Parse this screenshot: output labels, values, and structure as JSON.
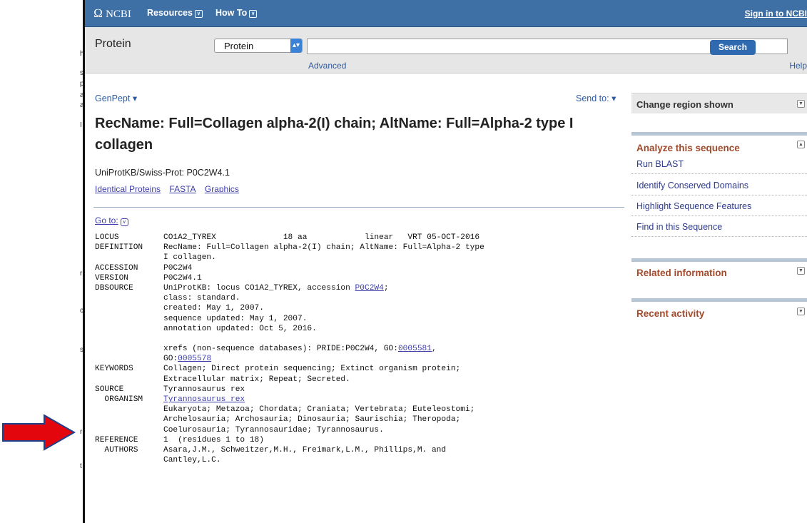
{
  "left_fragments": [
    "h",
    "s",
    "p",
    "a",
    "a",
    "I",
    "r",
    "c",
    "s",
    "r",
    "t"
  ],
  "topbar": {
    "logo_glyph": "Ω",
    "logo": "NCBI",
    "resources": "Resources",
    "howto": "How To",
    "caret": "∨",
    "signin": "Sign in to NCBI"
  },
  "search": {
    "db_label": "Protein",
    "db_value": "Protein",
    "db_arrow": "▴▾",
    "query": "",
    "button": "Search",
    "advanced": "Advanced",
    "help": "Help"
  },
  "main": {
    "format": "GenPept",
    "format_caret": "▾",
    "send_to": "Send to:",
    "send_caret": "▾",
    "title": "RecName: Full=Collagen alpha-2(I) chain; AltName: Full=Alpha-2 type I collagen",
    "accession_line": "UniProtKB/Swiss-Prot: P0C2W4.1",
    "links": [
      "Identical Proteins",
      "FASTA",
      "Graphics"
    ],
    "goto": "Go to:",
    "goto_caret": "∨"
  },
  "record": [
    {
      "key": "LOCUS",
      "text": "CO1A2_TYREX              18 aa            linear   VRT 05-OCT-2016"
    },
    {
      "key": "DEFINITION",
      "text": "RecName: Full=Collagen alpha-2(I) chain; AltName: Full=Alpha-2 type"
    },
    {
      "key": "",
      "text": "I collagen."
    },
    {
      "key": "ACCESSION",
      "text": "P0C2W4"
    },
    {
      "key": "VERSION",
      "text": "P0C2W4.1"
    },
    {
      "key": "DBSOURCE",
      "text": "UniProtKB: locus CO1A2_TYREX, accession ",
      "link": "P0C2W4",
      "after": ";"
    },
    {
      "key": "",
      "text": "class: standard."
    },
    {
      "key": "",
      "text": "created: May 1, 2007."
    },
    {
      "key": "",
      "text": "sequence updated: May 1, 2007."
    },
    {
      "key": "",
      "text": "annotation updated: Oct 5, 2016."
    },
    {
      "key": "",
      "text": ""
    },
    {
      "key": "",
      "text": "xrefs (non-sequence databases): PRIDE:P0C2W4, GO:",
      "link": "0005581",
      "after": ","
    },
    {
      "key": "",
      "text": "GO:",
      "link": "0005578",
      "after": ""
    },
    {
      "key": "KEYWORDS",
      "text": "Collagen; Direct protein sequencing; Extinct organism protein;"
    },
    {
      "key": "",
      "text": "Extracellular matrix; Repeat; Secreted."
    },
    {
      "key": "SOURCE",
      "text": "Tyrannosaurus rex"
    },
    {
      "key": "  ORGANISM",
      "text": "",
      "link": "Tyrannosaurus rex",
      "after": ""
    },
    {
      "key": "",
      "text": "Eukaryota; Metazoa; Chordata; Craniata; Vertebrata; Euteleostomi;"
    },
    {
      "key": "",
      "text": "Archelosauria; Archosauria; Dinosauria; Saurischia; Theropoda;"
    },
    {
      "key": "",
      "text": "Coelurosauria; Tyrannosauridae; Tyrannosaurus."
    },
    {
      "key": "REFERENCE",
      "text": "1  (residues 1 to 18)"
    },
    {
      "key": "  AUTHORS",
      "text": "Asara,J.M., Schweitzer,M.H., Freimark,L.M., Phillips,M. and"
    },
    {
      "key": "",
      "text": "Cantley,L.C."
    }
  ],
  "sidebar": {
    "change_region": "Change region shown",
    "analyze": {
      "title": "Analyze this sequence",
      "items": [
        "Run BLAST",
        "Identify Conserved Domains",
        "Highlight Sequence Features",
        "Find in this Sequence"
      ]
    },
    "related": "Related information",
    "recent": "Recent activity",
    "toggle_down": "▼",
    "toggle_up": "▲"
  },
  "annotation": {
    "arrow_color": "#e3070d",
    "arrow_outline": "#1f3f8a"
  }
}
